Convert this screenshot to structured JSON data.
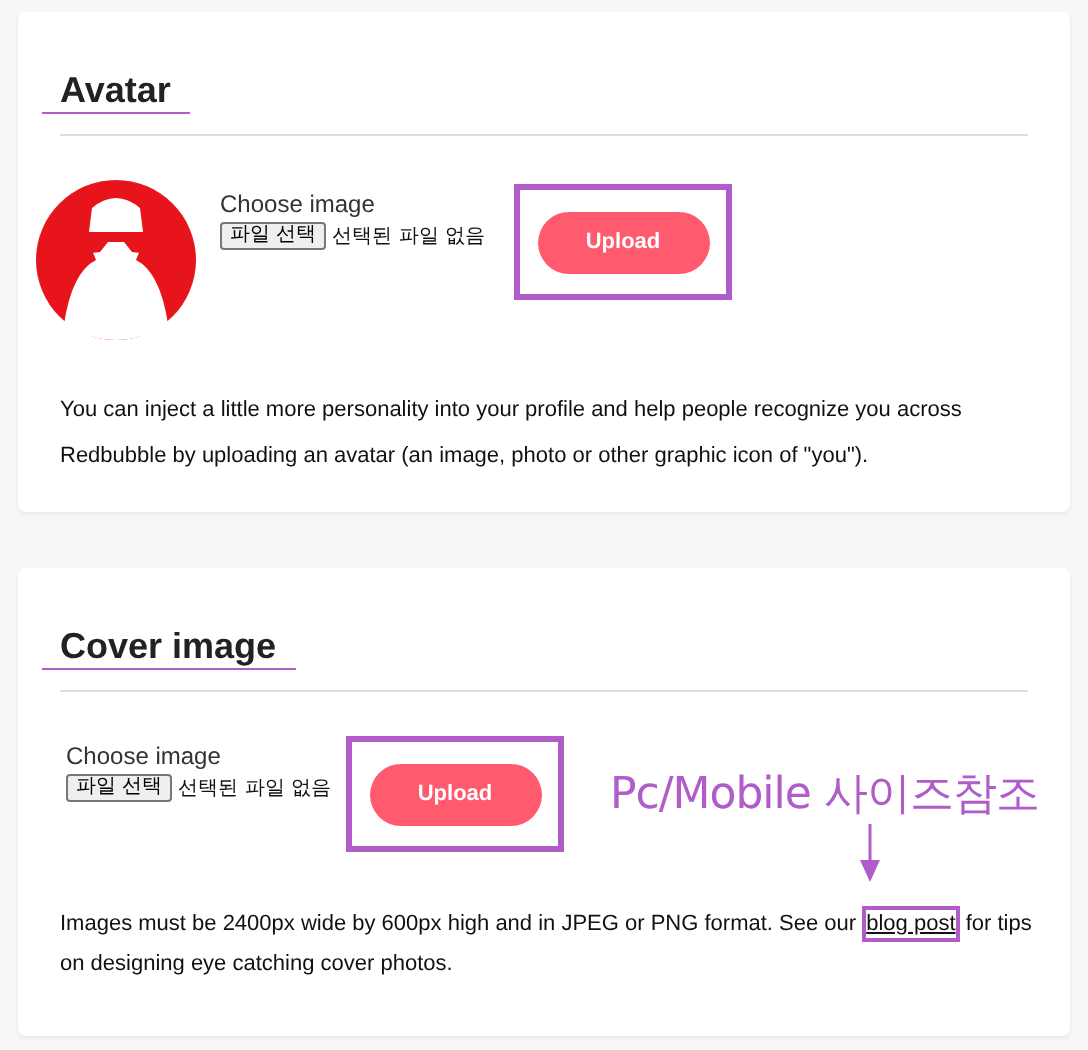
{
  "sections": [
    {
      "title": "Avatar",
      "title_underlined": true,
      "has_avatar": true,
      "choose_label": "Choose image",
      "file_button": "파일 선택",
      "file_status": "선택된 파일 없음",
      "upload": {
        "label": "Upload",
        "highlighted": true
      },
      "description": [
        {
          "kind": "text",
          "text": "You can inject a little more personality into your profile and help people recognize you across Redbubble by uploading an avatar (an image, photo or other graphic icon of \"you\")."
        }
      ]
    },
    {
      "title": "Cover image",
      "title_underlined": true,
      "has_avatar": false,
      "choose_label": "Choose image",
      "file_button": "파일 선택",
      "file_status": "선택된 파일 없음",
      "upload": {
        "label": "Upload",
        "highlighted": true
      },
      "annotation": "Pc/Mobile 사이즈참조",
      "description": [
        {
          "kind": "text",
          "text": "Images must be 2400px wide by 600px high and in JPEG or PNG format. See our "
        },
        {
          "kind": "link",
          "text": "blog post",
          "highlighted": true
        },
        {
          "kind": "text",
          "text": " for tips on designing eye catching cover photos."
        }
      ]
    }
  ]
}
